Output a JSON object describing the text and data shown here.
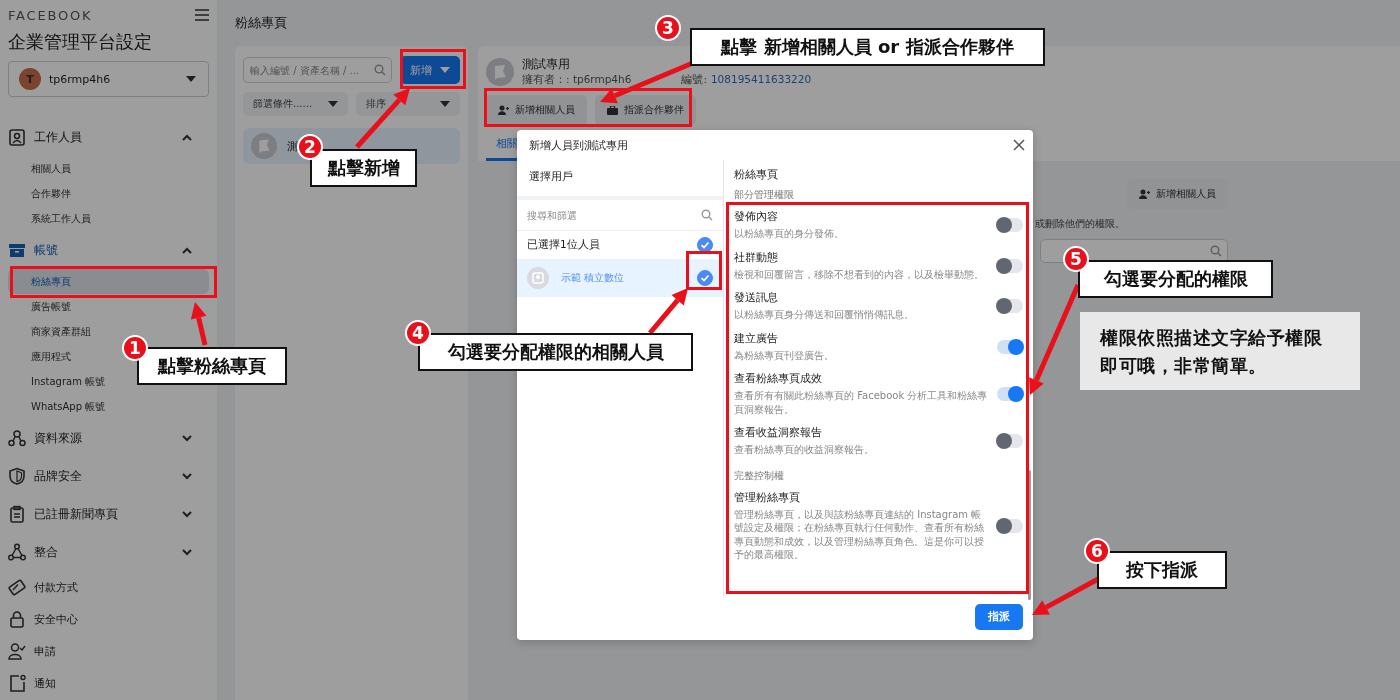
{
  "sidebar": {
    "brand": "FACEBOOK",
    "title": "企業管理平台設定",
    "account": {
      "initial": "T",
      "name": "tp6rmp4h6"
    },
    "sections": [
      {
        "kind": "group",
        "label": "工作人員",
        "selected": false,
        "expanded": true,
        "children": [
          {
            "label": "相關人員",
            "selected": false
          },
          {
            "label": "合作夥伴",
            "selected": false
          },
          {
            "label": "系統工作人員",
            "selected": false
          }
        ]
      },
      {
        "kind": "group",
        "label": "帳號",
        "selected": true,
        "expanded": true,
        "children": [
          {
            "label": "粉絲專頁",
            "selected": true
          },
          {
            "label": "廣告帳號",
            "selected": false
          },
          {
            "label": "商家資產群組",
            "selected": false
          },
          {
            "label": "應用程式",
            "selected": false
          },
          {
            "label": "Instagram 帳號",
            "selected": false
          },
          {
            "label": "WhatsApp 帳號",
            "selected": false
          }
        ]
      },
      {
        "kind": "group",
        "label": "資料來源",
        "selected": false,
        "expanded": false
      },
      {
        "kind": "group",
        "label": "品牌安全",
        "selected": false,
        "expanded": false
      },
      {
        "kind": "group",
        "label": "已註冊新聞專頁",
        "selected": false,
        "expanded": false
      },
      {
        "kind": "group",
        "label": "整合",
        "selected": false,
        "expanded": false
      },
      {
        "kind": "link",
        "label": "付款方式",
        "selected": false
      },
      {
        "kind": "link",
        "label": "安全中心",
        "selected": false
      },
      {
        "kind": "link",
        "label": "申請",
        "selected": false
      },
      {
        "kind": "link",
        "label": "通知",
        "selected": false
      }
    ]
  },
  "page_title": "粉絲專頁",
  "asset_list": {
    "search_placeholder": "輸入編號 / 資產名稱 / ...",
    "add_button": "新增",
    "filter": "篩選條件......",
    "sort": "排序",
    "items": [
      {
        "name": "測",
        "selected": true
      }
    ]
  },
  "detail": {
    "name": "測試專用",
    "owner": "擁有者：: tp6rmp4h6",
    "id_label": "編號:",
    "id": "108195411633220",
    "buttons": [
      "新增相關人員",
      "指派合作夥伴"
    ],
    "tabs": [
      {
        "label": "相關",
        "selected": true
      }
    ],
    "add_button": "新增相關人員",
    "note": "或刪除他們的權限。"
  },
  "modal": {
    "title": "新增人員到測試專用",
    "left_heading": "選擇用戶",
    "search_placeholder": "搜尋和篩選",
    "selected_count": "已選擇1位人員",
    "all_checked": true,
    "people": [
      {
        "name": "示範 積立數位",
        "selected": true
      }
    ],
    "asset": "粉絲專頁",
    "groups": [
      {
        "heading": "部分管理權限",
        "permissions": [
          {
            "title": "發佈內容",
            "desc": "以粉絲專頁的身分發佈。",
            "on": false
          },
          {
            "title": "社群動態",
            "desc": "檢視和回覆留言，移除不想看到的內容，以及檢舉動態。",
            "on": false
          },
          {
            "title": "發送訊息",
            "desc": "以粉絲專頁身分傳送和回覆悄悄傳訊息。",
            "on": false
          },
          {
            "title": "建立廣告",
            "desc": "為粉絲專頁刊登廣告。",
            "on": true
          },
          {
            "title": "查看粉絲專頁成效",
            "desc": "查看所有有關此粉絲專頁的 Facebook 分析工具和粉絲專頁洞察報告。",
            "on": true
          },
          {
            "title": "查看收益洞察報告",
            "desc": "查看粉絲專頁的收益洞察報告。",
            "on": false
          }
        ]
      },
      {
        "heading": "完整控制權",
        "permissions": [
          {
            "title": "管理粉絲專頁",
            "desc": "管理粉絲專頁，以及與該粉絲專頁連結的 Instagram 帳號設定及權限；在粉絲專頁執行任何動作、查看所有粉絲專頁動態和成效，以及管理粉絲專頁角色。這是你可以授予的最高權限。",
            "on": false
          }
        ]
      }
    ],
    "submit": "指派"
  },
  "annotations": [
    {
      "number": "1",
      "text": "點擊粉絲專頁"
    },
    {
      "number": "2",
      "text": "點擊新增"
    },
    {
      "number": "3",
      "text": "點擊 新增相關人員 or 指派合作夥伴"
    },
    {
      "number": "4",
      "text": "勾選要分配權限的相關人員"
    },
    {
      "number": "5",
      "text": "勾選要分配的權限"
    },
    {
      "number": "6",
      "text": "按下指派"
    }
  ],
  "note": "權限依照描述文字給予權限即可哦，非常簡單。"
}
